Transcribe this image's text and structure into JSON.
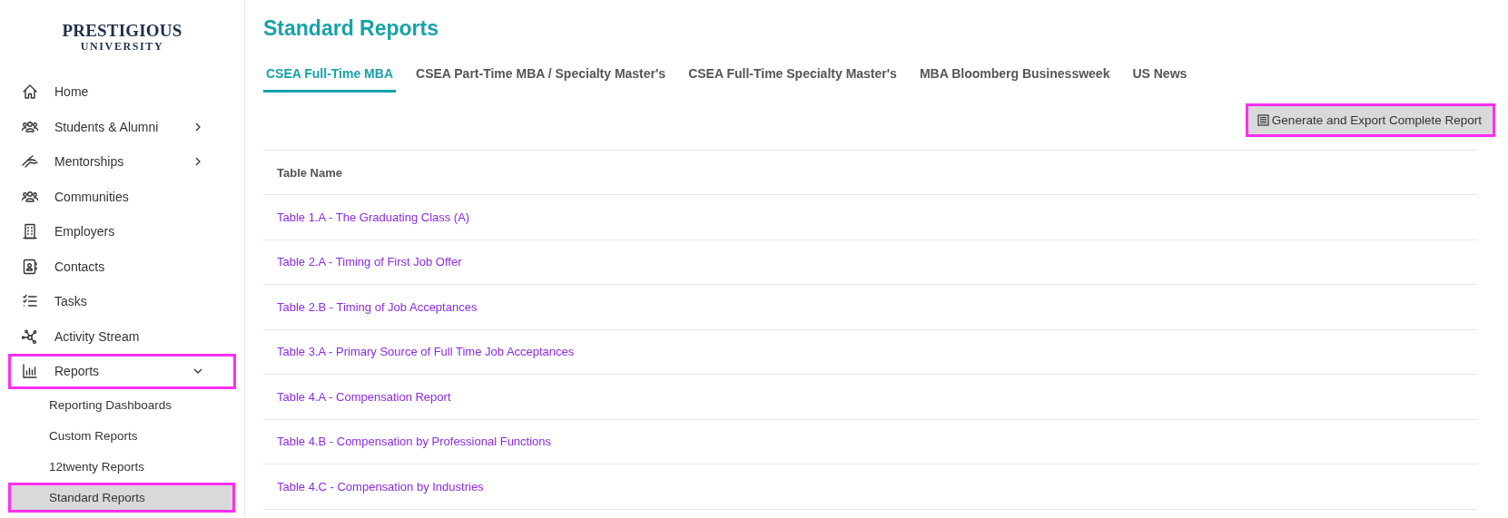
{
  "logo": {
    "line1": "PRESTIGIOUS",
    "line2": "UNIVERSITY"
  },
  "sidebar": {
    "items": [
      {
        "label": "Home",
        "highlighted": false
      },
      {
        "label": "Students & Alumni",
        "expanded": false,
        "highlighted": false
      },
      {
        "label": "Mentorships",
        "expanded": false,
        "highlighted": false
      },
      {
        "label": "Communities",
        "highlighted": false
      },
      {
        "label": "Employers",
        "highlighted": false
      },
      {
        "label": "Contacts",
        "highlighted": false
      },
      {
        "label": "Tasks",
        "highlighted": false
      },
      {
        "label": "Activity Stream",
        "highlighted": false
      },
      {
        "label": "Reports",
        "expanded": true,
        "highlighted": true,
        "children": [
          {
            "label": "Reporting Dashboards",
            "selected": false,
            "highlighted": false
          },
          {
            "label": "Custom Reports",
            "selected": false,
            "highlighted": false
          },
          {
            "label": "12twenty Reports",
            "selected": false,
            "highlighted": false
          },
          {
            "label": "Standard Reports",
            "selected": true,
            "highlighted": true
          }
        ]
      }
    ]
  },
  "page": {
    "title": "Standard Reports"
  },
  "tabs": [
    {
      "label": "CSEA Full-Time MBA",
      "selected": true
    },
    {
      "label": "CSEA Part-Time MBA / Specialty Master's",
      "selected": false
    },
    {
      "label": "CSEA Full-Time Specialty Master's",
      "selected": false
    },
    {
      "label": "MBA Bloomberg Businessweek",
      "selected": false
    },
    {
      "label": "US News",
      "selected": false
    }
  ],
  "export_button": {
    "label": "Generate and Export Complete Report",
    "highlighted": true
  },
  "table": {
    "columns": [
      "Table Name"
    ],
    "rows": [
      "Table 1.A - The Graduating Class (A)",
      "Table 2.A - Timing of First Job Offer",
      "Table 2.B - Timing of Job Acceptances",
      "Table 3.A - Primary Source of Full Time Job Acceptances",
      "Table 4.A - Compensation Report",
      "Table 4.B - Compensation by Professional Functions",
      "Table 4.C - Compensation by Industries"
    ]
  }
}
